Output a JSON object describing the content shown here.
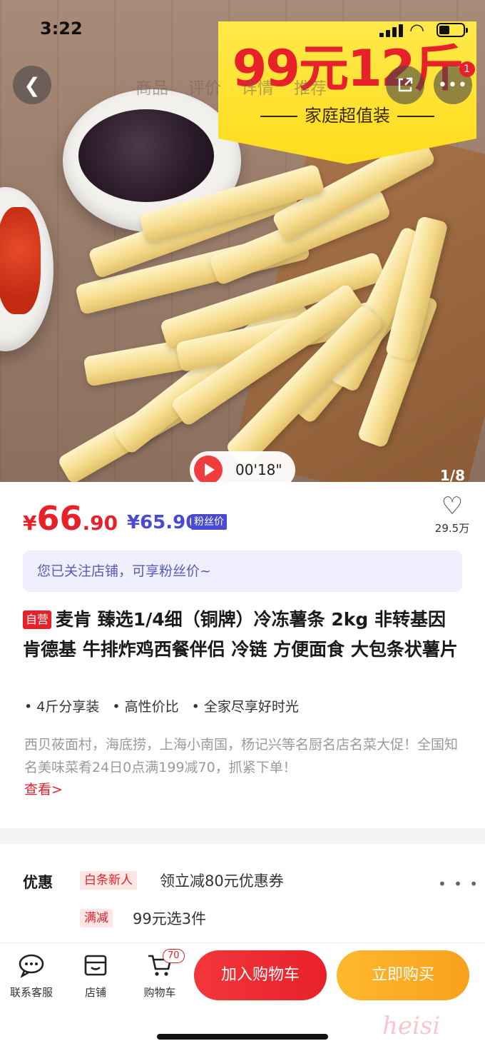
{
  "status_bar": {
    "time": "3:22"
  },
  "hero": {
    "promo_title": "99元12斤",
    "promo_subtitle": "家庭超值装",
    "tabs": [
      "商品",
      "评价",
      "详情",
      "推荐"
    ],
    "more_badge": "1",
    "video_duration": "00'18\"",
    "image_counter": "1/8"
  },
  "price": {
    "currency": "¥",
    "integer": "66",
    "decimal": ".90",
    "fan_price": "¥65.90",
    "fan_label": "粉丝价",
    "favorite_count": "29.5万"
  },
  "notice": "您已关注店铺，可享粉丝价~",
  "product": {
    "self_tag": "自营",
    "title": "麦肯 臻选1/4细（铜牌）冷冻薯条 2kg 非转基因 肯德基 牛排炸鸡西餐伴侣 冷链 方便面食 大包条状薯片",
    "features": [
      "4斤分享装",
      "高性价比",
      "全家尽享好时光"
    ],
    "promo_text": "西贝莜面村，海底捞，上海小南国，杨记兴等名厨名店名菜大促！全国知名美味菜肴24日0点满199减70，抓紧下单！",
    "see_more": "查看>"
  },
  "offers": {
    "label": "优惠",
    "items": [
      {
        "tag": "白条新人",
        "text": "领立减80元优惠券"
      },
      {
        "tag": "满减",
        "text": "99元选3件"
      }
    ],
    "more": "• • •"
  },
  "bottom_bar": {
    "items": [
      {
        "label": "联系客服",
        "icon": "chat-icon"
      },
      {
        "label": "店铺",
        "icon": "store-icon"
      },
      {
        "label": "购物车",
        "icon": "cart-icon"
      }
    ],
    "cart_badge": "70",
    "add_to_cart": "加入购物车",
    "buy_now": "立即购买",
    "watermark": "heisi"
  }
}
